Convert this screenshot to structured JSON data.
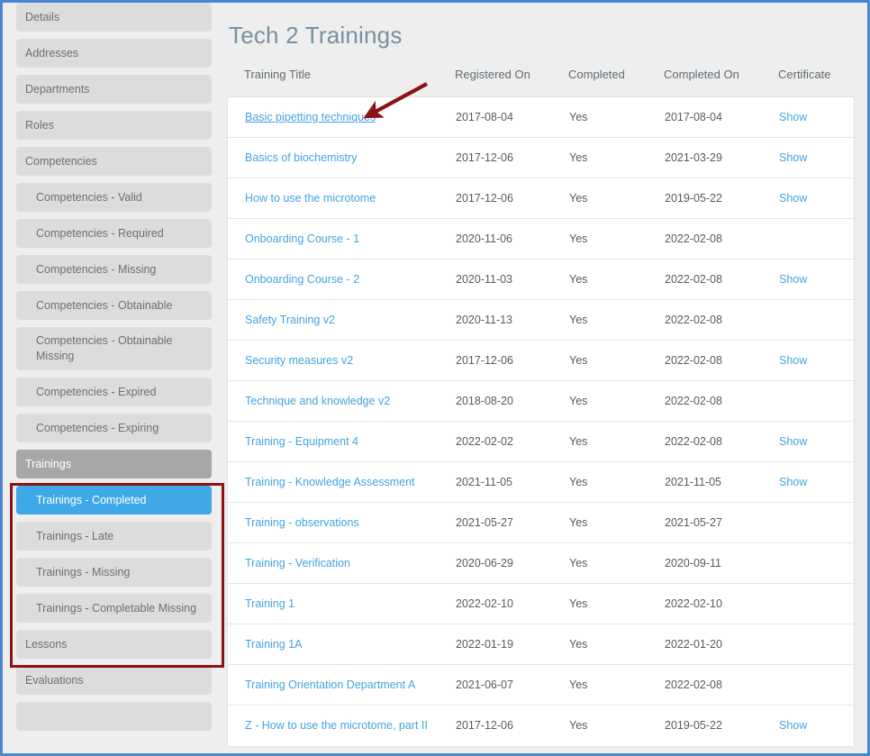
{
  "window": {
    "frame_color": "#4a86d4",
    "background_color": "#eeeeee"
  },
  "annotations": {
    "arrow_color": "#8b1216",
    "highlight_box_color": "#8b1216"
  },
  "sidebar": {
    "items": [
      {
        "label": "Details",
        "style": "normal"
      },
      {
        "label": "Addresses",
        "style": "normal"
      },
      {
        "label": "Departments",
        "style": "normal"
      },
      {
        "label": "Roles",
        "style": "normal"
      },
      {
        "label": "Competencies",
        "style": "normal"
      },
      {
        "label": "Competencies - Valid",
        "style": "sub"
      },
      {
        "label": "Competencies - Required",
        "style": "sub"
      },
      {
        "label": "Competencies - Missing",
        "style": "sub"
      },
      {
        "label": "Competencies - Obtainable",
        "style": "sub"
      },
      {
        "label": "Competencies - Obtainable Missing",
        "style": "sub-two-line"
      },
      {
        "label": "Competencies - Expired",
        "style": "sub"
      },
      {
        "label": "Competencies - Expiring",
        "style": "sub"
      },
      {
        "label": "Trainings",
        "style": "group-header"
      },
      {
        "label": "Trainings - Completed",
        "style": "active"
      },
      {
        "label": "Trainings - Late",
        "style": "sub"
      },
      {
        "label": "Trainings - Missing",
        "style": "sub"
      },
      {
        "label": "Trainings - Completable Missing",
        "style": "sub"
      },
      {
        "label": "Lessons",
        "style": "normal"
      },
      {
        "label": "Evaluations",
        "style": "normal"
      },
      {
        "label": "",
        "style": "normal"
      }
    ],
    "highlighted_group": {
      "first_index": 12,
      "last_index": 16
    }
  },
  "main": {
    "title": "Tech 2 Trainings",
    "table": {
      "columns": [
        "Training Title",
        "Registered On",
        "Completed",
        "Completed On",
        "Certificate"
      ],
      "certificate_link_label": "Show",
      "rows": [
        {
          "title": "Basic pipetting techniques",
          "registered_on": "2017-08-04",
          "completed": "Yes",
          "completed_on": "2017-08-04",
          "certificate": "Show",
          "hovered": true
        },
        {
          "title": "Basics of biochemistry",
          "registered_on": "2017-12-06",
          "completed": "Yes",
          "completed_on": "2021-03-29",
          "certificate": "Show",
          "hovered": false
        },
        {
          "title": "How to use the microtome",
          "registered_on": "2017-12-06",
          "completed": "Yes",
          "completed_on": "2019-05-22",
          "certificate": "Show",
          "hovered": false
        },
        {
          "title": "Onboarding Course - 1",
          "registered_on": "2020-11-06",
          "completed": "Yes",
          "completed_on": "2022-02-08",
          "certificate": "",
          "hovered": false
        },
        {
          "title": "Onboarding Course - 2",
          "registered_on": "2020-11-03",
          "completed": "Yes",
          "completed_on": "2022-02-08",
          "certificate": "Show",
          "hovered": false
        },
        {
          "title": "Safety Training v2",
          "registered_on": "2020-11-13",
          "completed": "Yes",
          "completed_on": "2022-02-08",
          "certificate": "",
          "hovered": false
        },
        {
          "title": "Security measures v2",
          "registered_on": "2017-12-06",
          "completed": "Yes",
          "completed_on": "2022-02-08",
          "certificate": "Show",
          "hovered": false
        },
        {
          "title": "Technique and knowledge v2",
          "registered_on": "2018-08-20",
          "completed": "Yes",
          "completed_on": "2022-02-08",
          "certificate": "",
          "hovered": false
        },
        {
          "title": "Training - Equipment 4",
          "registered_on": "2022-02-02",
          "completed": "Yes",
          "completed_on": "2022-02-08",
          "certificate": "Show",
          "hovered": false
        },
        {
          "title": "Training - Knowledge Assessment",
          "registered_on": "2021-11-05",
          "completed": "Yes",
          "completed_on": "2021-11-05",
          "certificate": "Show",
          "hovered": false
        },
        {
          "title": "Training - observations",
          "registered_on": "2021-05-27",
          "completed": "Yes",
          "completed_on": "2021-05-27",
          "certificate": "",
          "hovered": false
        },
        {
          "title": "Training - Verification",
          "registered_on": "2020-06-29",
          "completed": "Yes",
          "completed_on": "2020-09-11",
          "certificate": "",
          "hovered": false
        },
        {
          "title": "Training 1",
          "registered_on": "2022-02-10",
          "completed": "Yes",
          "completed_on": "2022-02-10",
          "certificate": "",
          "hovered": false
        },
        {
          "title": "Training 1A",
          "registered_on": "2022-01-19",
          "completed": "Yes",
          "completed_on": "2022-01-20",
          "certificate": "",
          "hovered": false
        },
        {
          "title": "Training Orientation Department A",
          "registered_on": "2021-06-07",
          "completed": "Yes",
          "completed_on": "2022-02-08",
          "certificate": "",
          "hovered": false
        },
        {
          "title": "Z - How to use the microtome, part II",
          "registered_on": "2017-12-06",
          "completed": "Yes",
          "completed_on": "2019-05-22",
          "certificate": "Show",
          "hovered": false
        }
      ]
    }
  }
}
